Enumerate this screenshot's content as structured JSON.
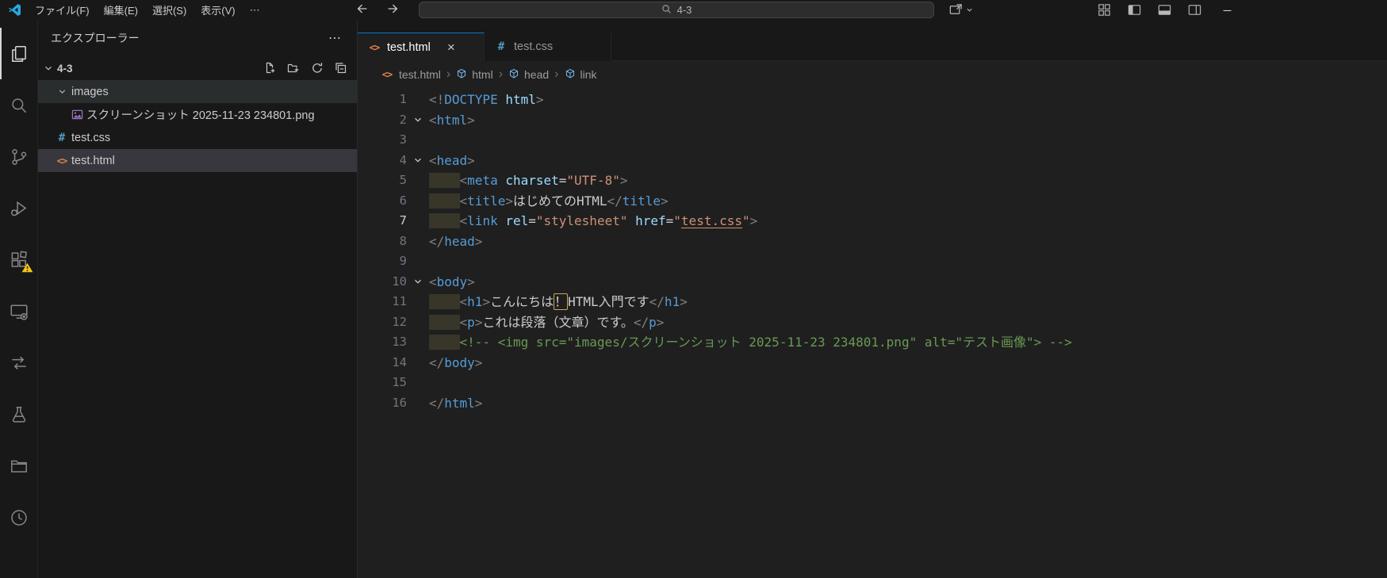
{
  "icons": {
    "more_actions": "⋯",
    "breadcrumb_separator": "›",
    "close_tab": "×",
    "html_file_glyph": "<>",
    "css_file_glyph": "#"
  },
  "colors": {
    "chrome_bg": "#181818",
    "editor_bg": "#1f1f1f",
    "accent": "#0078d4",
    "list_selected": "#37373d",
    "list_hover": "#2a2d2e",
    "tag": "#569cd6",
    "attribute": "#9cdcfe",
    "string": "#ce9178",
    "punctuation": "#808080",
    "comment": "#6a9955",
    "html_icon": "#e8834a",
    "css_icon": "#519aba",
    "image_icon": "#a074c4",
    "warning_badge": "#f5c518"
  },
  "title_bar": {
    "menus": [
      "ファイル(F)",
      "編集(E)",
      "選択(S)",
      "表示(V)"
    ],
    "search_value": "4-3"
  },
  "activity_bar": {
    "items": [
      {
        "name": "explorer",
        "active": true
      },
      {
        "name": "search"
      },
      {
        "name": "source-control"
      },
      {
        "name": "run-and-debug"
      },
      {
        "name": "extensions",
        "badge": "warning"
      },
      {
        "name": "remote-monitor"
      },
      {
        "name": "pull-request"
      },
      {
        "name": "testing"
      },
      {
        "name": "library-folder"
      },
      {
        "name": "timeline-clock"
      }
    ]
  },
  "sidebar": {
    "title": "エクスプローラー",
    "section_label": "4-3",
    "actions": [
      "new-file",
      "new-folder",
      "refresh",
      "collapse-all"
    ],
    "tree": [
      {
        "label": "images",
        "kind": "folder",
        "depth": 0,
        "expanded": true,
        "state": "hovered"
      },
      {
        "label": "スクリーンショット 2025-11-23 234801.png",
        "kind": "image",
        "depth": 1,
        "state": "none"
      },
      {
        "label": "test.css",
        "kind": "css",
        "depth": 0,
        "state": "none"
      },
      {
        "label": "test.html",
        "kind": "html",
        "depth": 0,
        "state": "selected"
      }
    ]
  },
  "editor_group": {
    "tabs": [
      {
        "label": "test.html",
        "kind": "html",
        "active": true,
        "closable": true
      },
      {
        "label": "test.css",
        "kind": "css",
        "active": false,
        "closable": false
      }
    ],
    "breadcrumbs": [
      {
        "label": "test.html",
        "icon": "html-file"
      },
      {
        "label": "html",
        "icon": "symbol"
      },
      {
        "label": "head",
        "icon": "symbol"
      },
      {
        "label": "link",
        "icon": "symbol"
      }
    ]
  },
  "editor": {
    "active_line": 7,
    "fold_lines": [
      2,
      4,
      10
    ],
    "lines": [
      {
        "n": 1,
        "tokens": [
          [
            "p",
            "<!"
          ],
          [
            "tag",
            "DOCTYPE"
          ],
          [
            "attr",
            " html"
          ],
          [
            "p",
            ">"
          ]
        ]
      },
      {
        "n": 2,
        "tokens": [
          [
            "p",
            "<"
          ],
          [
            "tag",
            "html"
          ],
          [
            "p",
            ">"
          ]
        ]
      },
      {
        "n": 3,
        "tokens": []
      },
      {
        "n": 4,
        "tokens": [
          [
            "p",
            "<"
          ],
          [
            "tag",
            "head"
          ],
          [
            "p",
            ">"
          ]
        ]
      },
      {
        "n": 5,
        "tokens": [
          [
            "ind",
            "    "
          ],
          [
            "p",
            "<"
          ],
          [
            "tag",
            "meta"
          ],
          [
            "attr",
            " charset"
          ],
          [
            "eq",
            "="
          ],
          [
            "str",
            "\"UTF-8\""
          ],
          [
            "p",
            ">"
          ]
        ]
      },
      {
        "n": 6,
        "tokens": [
          [
            "ind",
            "    "
          ],
          [
            "p",
            "<"
          ],
          [
            "tag",
            "title"
          ],
          [
            "p",
            ">"
          ],
          [
            "txt",
            "はじめてのHTML"
          ],
          [
            "p",
            "</"
          ],
          [
            "tag",
            "title"
          ],
          [
            "p",
            ">"
          ]
        ]
      },
      {
        "n": 7,
        "tokens": [
          [
            "ind",
            "    "
          ],
          [
            "p",
            "<"
          ],
          [
            "tag",
            "link"
          ],
          [
            "attr",
            " rel"
          ],
          [
            "eq",
            "="
          ],
          [
            "str",
            "\"stylesheet\""
          ],
          [
            "attr",
            " href"
          ],
          [
            "eq",
            "="
          ],
          [
            "str",
            "\""
          ],
          [
            "strlink",
            "test.css"
          ],
          [
            "str",
            "\""
          ],
          [
            "p",
            ">"
          ]
        ]
      },
      {
        "n": 8,
        "tokens": [
          [
            "p",
            "</"
          ],
          [
            "tag",
            "head"
          ],
          [
            "p",
            ">"
          ]
        ]
      },
      {
        "n": 9,
        "tokens": []
      },
      {
        "n": 10,
        "tokens": [
          [
            "p",
            "<"
          ],
          [
            "tag",
            "body"
          ],
          [
            "p",
            ">"
          ]
        ]
      },
      {
        "n": 11,
        "tokens": [
          [
            "ind",
            "    "
          ],
          [
            "p",
            "<"
          ],
          [
            "tag",
            "h1"
          ],
          [
            "p",
            ">"
          ],
          [
            "txt",
            "こんにちは"
          ],
          [
            "boxed",
            "！"
          ],
          [
            "txt",
            "HTML入門です"
          ],
          [
            "p",
            "</"
          ],
          [
            "tag",
            "h1"
          ],
          [
            "p",
            ">"
          ]
        ]
      },
      {
        "n": 12,
        "tokens": [
          [
            "ind",
            "    "
          ],
          [
            "p",
            "<"
          ],
          [
            "tag",
            "p"
          ],
          [
            "p",
            ">"
          ],
          [
            "txt",
            "これは段落（文章）です。"
          ],
          [
            "p",
            "</"
          ],
          [
            "tag",
            "p"
          ],
          [
            "p",
            ">"
          ]
        ]
      },
      {
        "n": 13,
        "tokens": [
          [
            "ind",
            "    "
          ],
          [
            "comment",
            "<!-- <img src=\"images/スクリーンショット 2025-11-23 234801.png\" alt=\"テスト画像\"> -->"
          ]
        ]
      },
      {
        "n": 14,
        "tokens": [
          [
            "p",
            "</"
          ],
          [
            "tag",
            "body"
          ],
          [
            "p",
            ">"
          ]
        ]
      },
      {
        "n": 15,
        "tokens": []
      },
      {
        "n": 16,
        "tokens": [
          [
            "p",
            "</"
          ],
          [
            "tag",
            "html"
          ],
          [
            "p",
            ">"
          ]
        ]
      }
    ]
  }
}
